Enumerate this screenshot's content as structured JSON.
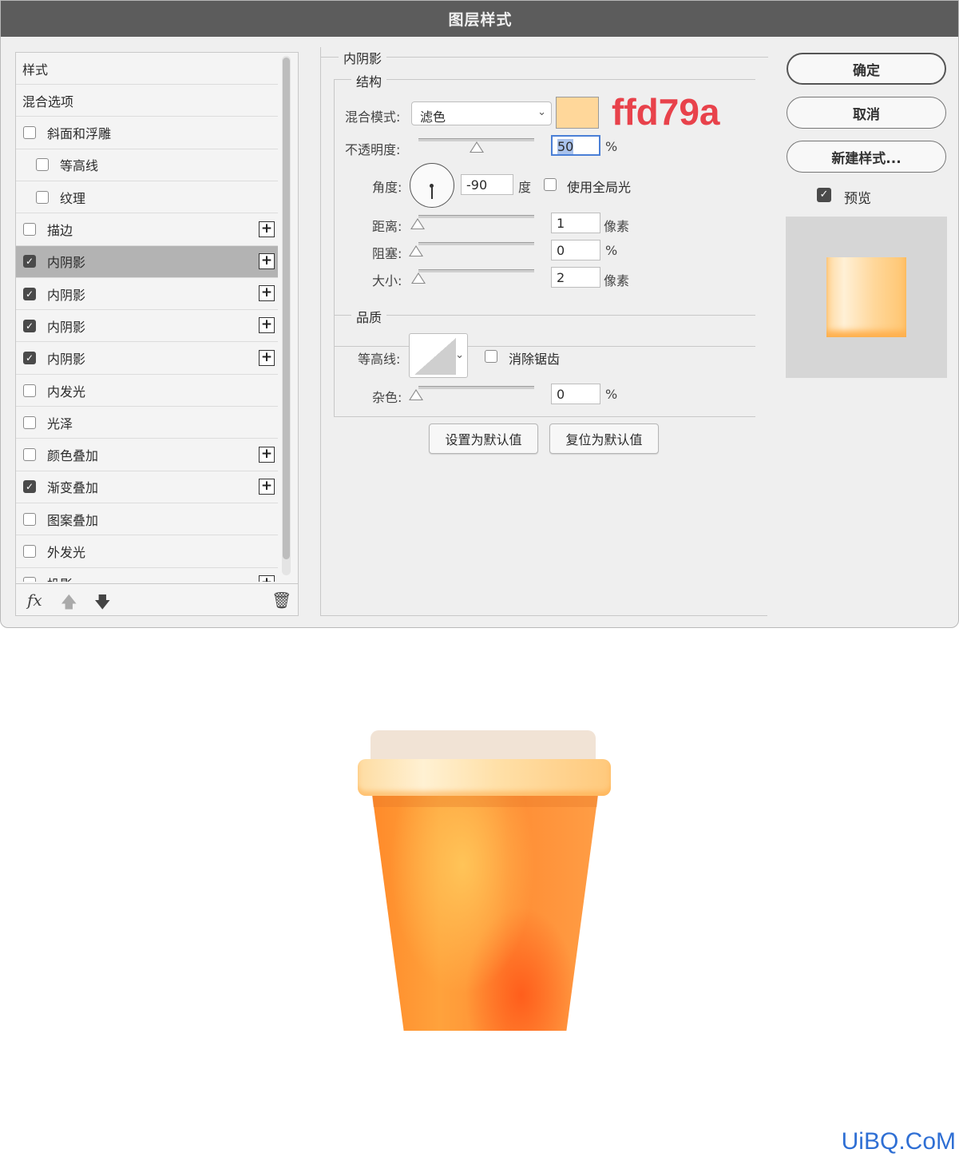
{
  "window": {
    "title": "图层样式"
  },
  "styles_panel": {
    "items": [
      {
        "label": "样式",
        "checkbox": null,
        "plus": false,
        "indent": 0,
        "selected": false
      },
      {
        "label": "混合选项",
        "checkbox": null,
        "plus": false,
        "indent": 0,
        "selected": false
      },
      {
        "label": "斜面和浮雕",
        "checkbox": false,
        "plus": false,
        "indent": 0,
        "selected": false
      },
      {
        "label": "等高线",
        "checkbox": false,
        "plus": false,
        "indent": 1,
        "selected": false
      },
      {
        "label": "纹理",
        "checkbox": false,
        "plus": false,
        "indent": 1,
        "selected": false
      },
      {
        "label": "描边",
        "checkbox": false,
        "plus": true,
        "indent": 0,
        "selected": false
      },
      {
        "label": "内阴影",
        "checkbox": true,
        "plus": true,
        "indent": 0,
        "selected": true
      },
      {
        "label": "内阴影",
        "checkbox": true,
        "plus": true,
        "indent": 0,
        "selected": false
      },
      {
        "label": "内阴影",
        "checkbox": true,
        "plus": true,
        "indent": 0,
        "selected": false
      },
      {
        "label": "内阴影",
        "checkbox": true,
        "plus": true,
        "indent": 0,
        "selected": false
      },
      {
        "label": "内发光",
        "checkbox": false,
        "plus": false,
        "indent": 0,
        "selected": false
      },
      {
        "label": "光泽",
        "checkbox": false,
        "plus": false,
        "indent": 0,
        "selected": false
      },
      {
        "label": "颜色叠加",
        "checkbox": false,
        "plus": true,
        "indent": 0,
        "selected": false
      },
      {
        "label": "渐变叠加",
        "checkbox": true,
        "plus": true,
        "indent": 0,
        "selected": false
      },
      {
        "label": "图案叠加",
        "checkbox": false,
        "plus": false,
        "indent": 0,
        "selected": false
      },
      {
        "label": "外发光",
        "checkbox": false,
        "plus": false,
        "indent": 0,
        "selected": false
      },
      {
        "label": "投影",
        "checkbox": false,
        "plus": true,
        "indent": 0,
        "selected": false
      }
    ],
    "footer": {
      "fx": "fx",
      "up_icon": "arrow-up-icon",
      "down_icon": "arrow-down-icon",
      "trash_icon": "trash-icon"
    }
  },
  "inner_shadow": {
    "title": "内阴影",
    "structure": {
      "title": "结构",
      "blend_mode_label": "混合模式:",
      "blend_mode_value": "滤色",
      "color_hex": "ffd79a",
      "color": "#ffd79a",
      "opacity_label": "不透明度:",
      "opacity_value": "50",
      "opacity_unit": "%",
      "opacity_level": 0.5,
      "angle_label": "角度:",
      "angle_value": "-90",
      "angle_unit": "度",
      "global_light_label": "使用全局光",
      "distance_label": "距离:",
      "distance_value": "1",
      "distance_unit": "像素",
      "choke_label": "阻塞:",
      "choke_value": "0",
      "choke_unit": "%",
      "size_label": "大小:",
      "size_value": "2",
      "size_unit": "像素"
    },
    "quality": {
      "title": "品质",
      "contour_label": "等高线:",
      "antialias_label": "消除锯齿",
      "noise_label": "杂色:",
      "noise_value": "0",
      "noise_unit": "%"
    },
    "set_default": "设置为默认值",
    "reset_default": "复位为默认值"
  },
  "actions": {
    "ok": "确定",
    "cancel": "取消",
    "new_style": "新建样式...",
    "preview_label": "预览"
  },
  "watermark": "UiBQ.CoM"
}
